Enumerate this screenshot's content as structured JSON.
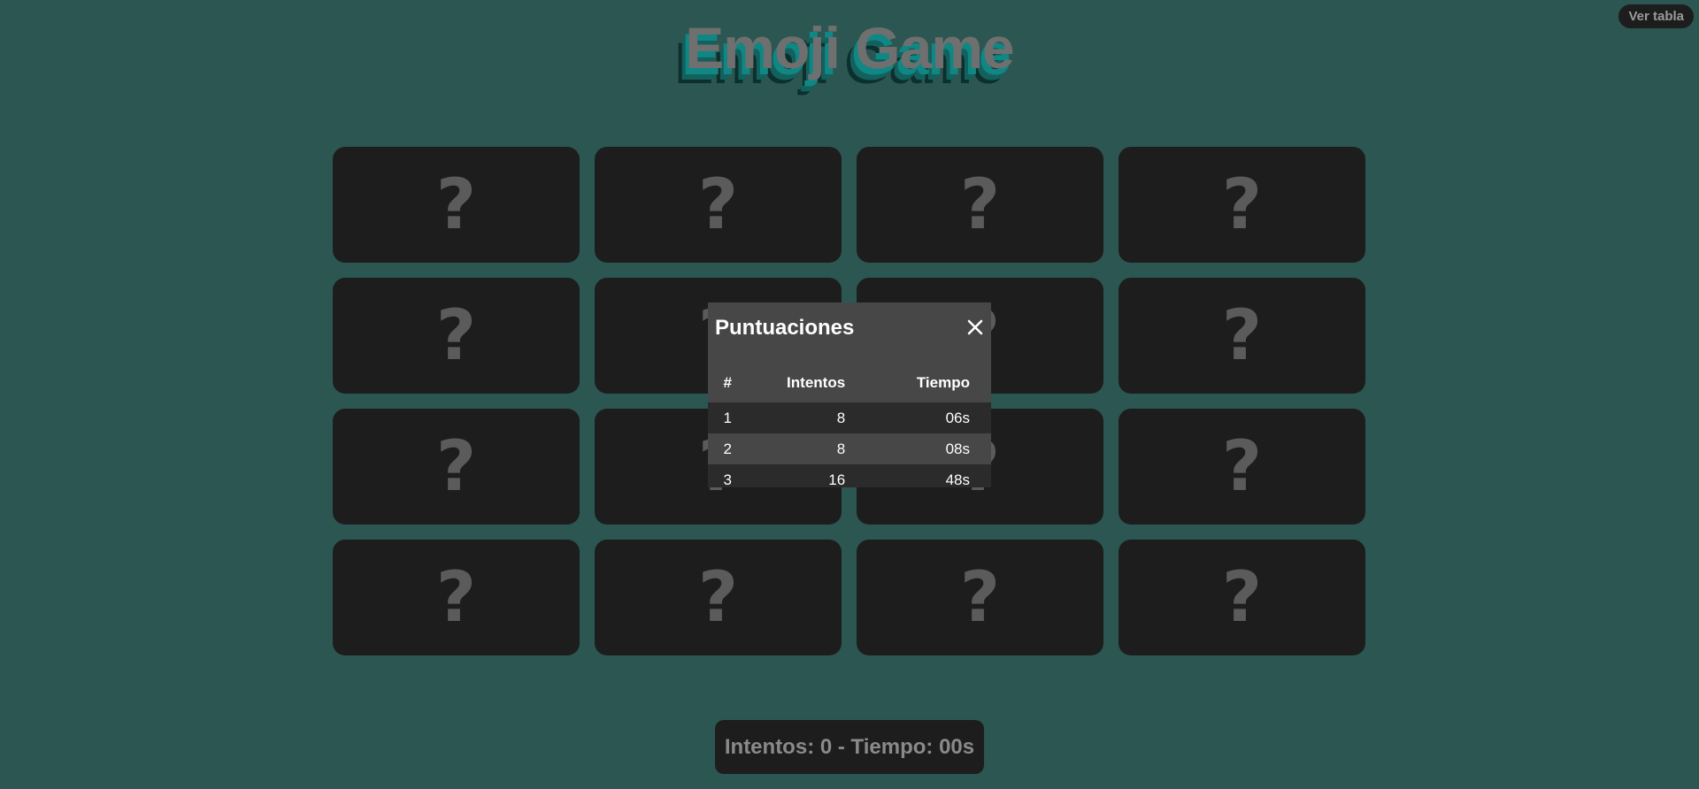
{
  "header": {
    "title": "Emoji Game",
    "view_table_label": "Ver tabla"
  },
  "board": {
    "cards": [
      "?",
      "?",
      "?",
      "?",
      "?",
      "?",
      "?",
      "?",
      "?",
      "?",
      "?",
      "?",
      "?",
      "?",
      "?",
      "?"
    ],
    "card_back_color": "#1d1d1d",
    "background_color": "#2b5651"
  },
  "scores_modal": {
    "title": "Puntuaciones",
    "close_icon": "close-icon",
    "columns": [
      "#",
      "Intentos",
      "Tiempo"
    ],
    "rows": [
      {
        "rank": "1",
        "attempts": "8",
        "time": "06s"
      },
      {
        "rank": "2",
        "attempts": "8",
        "time": "08s"
      },
      {
        "rank": "3",
        "attempts": "16",
        "time": "48s"
      }
    ]
  },
  "status": {
    "text": "Intentos: 0 - Tiempo: 00s"
  }
}
